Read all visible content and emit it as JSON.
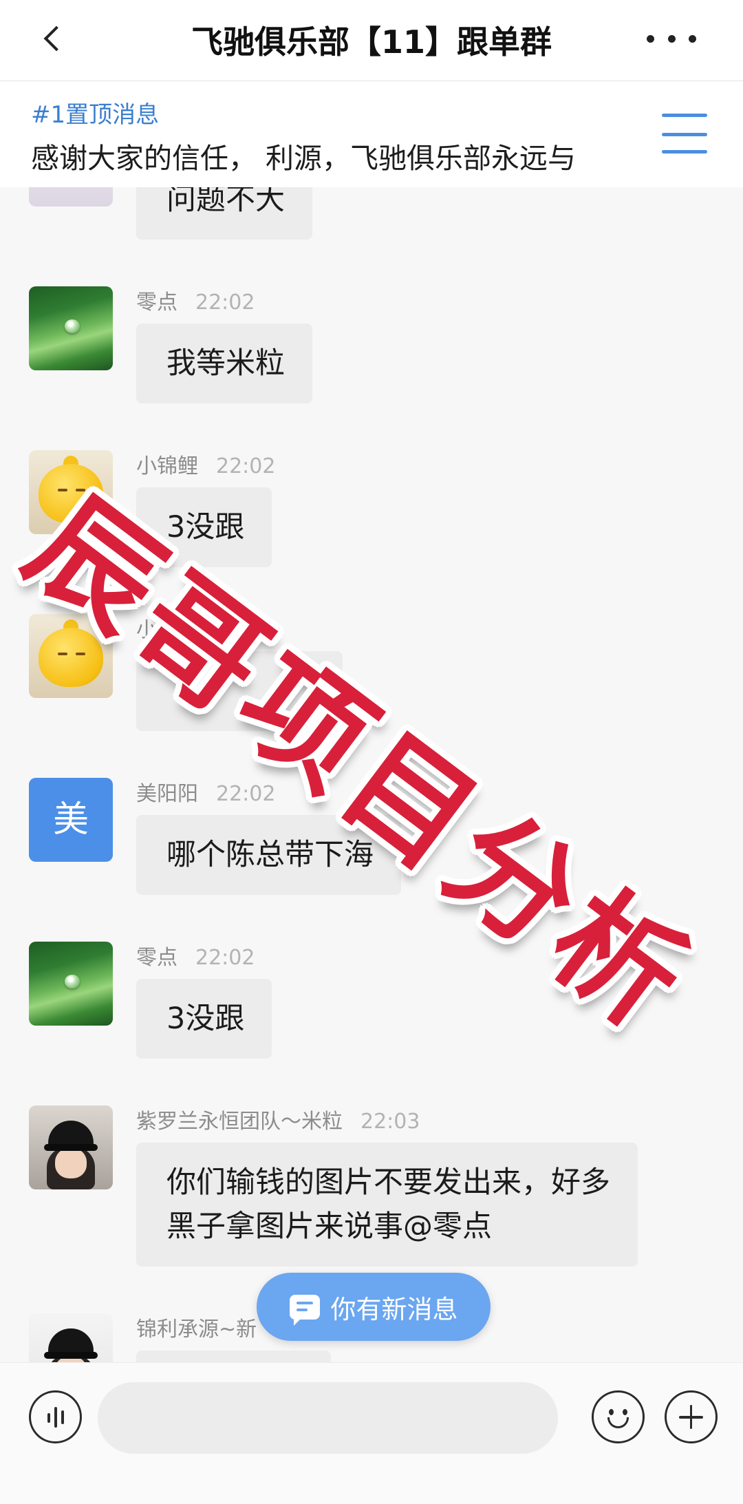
{
  "header": {
    "title": "飞驰俱乐部【11】跟单群",
    "back_icon": "chevron-left-icon",
    "more_icon": "more-dots-icon"
  },
  "pinned": {
    "tag": "#1置顶消息",
    "text": "感谢大家的信任， 利源，飞驰俱乐部永远与",
    "menu_icon": "hamburger-menu-icon"
  },
  "messages": [
    {
      "sender": "",
      "time": "",
      "avatar": "portrait-avatar",
      "lines": [
        "问题不大"
      ]
    },
    {
      "sender": "零点",
      "time": "22:02",
      "avatar": "leaf-avatar",
      "lines": [
        "我等米粒"
      ]
    },
    {
      "sender": "小锦鲤",
      "time": "22:02",
      "avatar": "duck-avatar",
      "lines": [
        "3没跟"
      ]
    },
    {
      "sender": "小",
      "time": "",
      "avatar": "duck-avatar",
      "lines": []
    },
    {
      "sender": "美阳阳",
      "time": "22:02",
      "avatar": "letter-avatar",
      "avatar_text": "美",
      "lines": [
        "哪个陈总带下海"
      ]
    },
    {
      "sender": "零点",
      "time": "22:02",
      "avatar": "leaf-avatar",
      "lines": [
        "3没跟"
      ]
    },
    {
      "sender": "紫罗兰永恒团队～米粒",
      "time": "22:03",
      "avatar": "cap-avatar",
      "lines": [
        "你们输钱的图片不要发出来，好多",
        "黑子拿图片来说事@零点"
      ]
    },
    {
      "sender": "锦利承源~新",
      "time": "",
      "avatar": "cap-avatar",
      "lines": []
    }
  ],
  "new_message_pill": {
    "label": "你有新消息",
    "icon": "message-icon"
  },
  "watermark": {
    "text": "辰哥项目分析"
  },
  "input_bar": {
    "voice_icon": "voice-icon",
    "emoji_icon": "emoji-icon",
    "plus_icon": "plus-icon"
  },
  "colors": {
    "accent": "#4a8ee0",
    "pill": "#6ba6f0",
    "watermark": "#d8203a",
    "avatar_blue": "#4b8fe8"
  }
}
